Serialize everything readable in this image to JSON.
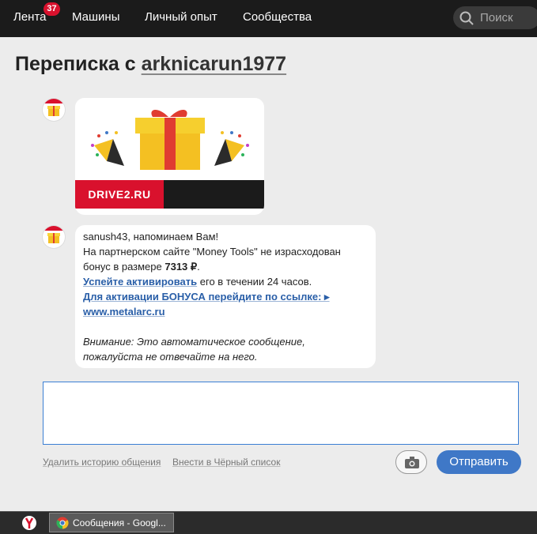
{
  "nav": {
    "items": [
      "Лента",
      "Машины",
      "Личный опыт",
      "Сообщества"
    ],
    "feed_badge": "37",
    "search_placeholder": "Поиск"
  },
  "page": {
    "title_prefix": "Переписка с",
    "title_user": "arknicarun1977"
  },
  "messages": {
    "banner_logo": "DRIVE2.RU",
    "text": {
      "greeting": "sanush43,  напоминаем Вам!",
      "line2": "На партнерском сайте \"Money Tools\" не израсходован",
      "line3_prefix": "бонус в размере ",
      "bonus_amount": "7313 ₽",
      "line3_suffix": ".",
      "activate_link": "Успейте активировать",
      "activate_suffix": " его в течении 24 часов.",
      "bonus_link_line1": "Для активации БОНУСА перейдите по ссылке: ▸",
      "bonus_link_line2": "www.metalarc.ru",
      "warning_line1": "Внимание: Это автоматическое сообщение,",
      "warning_line2": "пожалуйста не отвечайте на него."
    }
  },
  "reply": {
    "input_value": "",
    "delete_history_link": "Удалить историю общения",
    "blacklist_link": "Внести в Чёрный список",
    "send_button": "Отправить"
  },
  "taskbar": {
    "item_label": "Сообщения - Googl..."
  },
  "colors": {
    "accent_red": "#d9112d",
    "link_blue": "#2a5fa8",
    "send_blue": "#3f78c7"
  }
}
